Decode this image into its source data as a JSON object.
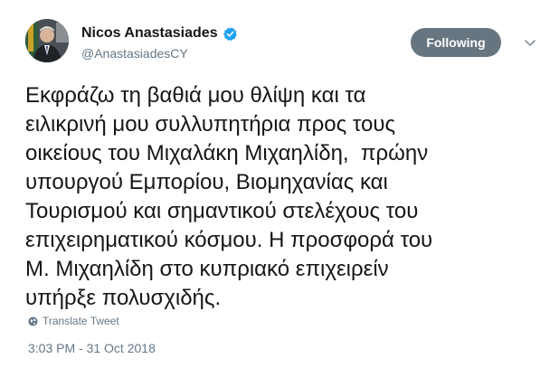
{
  "author": {
    "display_name": "Nicos Anastasiades",
    "handle": "@AnastasiadesCY",
    "verified_icon": "verified-badge-icon",
    "avatar_icon": "profile-photo"
  },
  "actions": {
    "follow_label": "Following",
    "more_icon": "chevron-down-icon"
  },
  "tweet": {
    "lines": [
      "Εκφράζω τη βαθιά μου θλίψη και τα",
      "ειλικρινή μου συλλυπητήρια προς τους",
      "οικείους του Μιχαλάκη Μιχαηλίδη,  πρώην",
      "υπουργού Εμπορίου, Βιομηχανίας και",
      "Τουρισμού και σημαντικού στελέχους του",
      "επιχειρηματικού κόσμου. Η προσφορά του",
      "Μ. Μιχαηλίδη στο κυπριακό επιχειρείν",
      "υπήρξε πολυσχιδής."
    ],
    "translate_label": "Translate Tweet",
    "translate_icon": "globe-icon",
    "timestamp": "3:03 PM - 31 Oct 2018"
  },
  "colors": {
    "text": "#14171a",
    "secondary": "#657786",
    "verified": "#1da1f2",
    "following_button": "#66757f"
  }
}
